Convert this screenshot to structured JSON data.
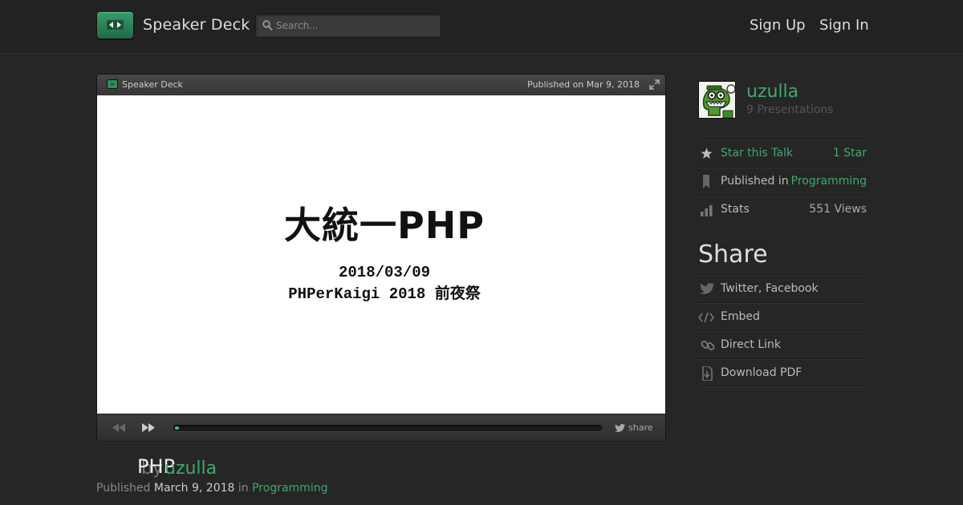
{
  "header": {
    "brand": "Speaker Deck",
    "search_placeholder": "Search...",
    "sign_up": "Sign Up",
    "sign_in": "Sign In"
  },
  "player": {
    "brand": "Speaker Deck",
    "published_on": "Published on Mar 9, 2018",
    "slide": {
      "title": "大統一PHP",
      "date": "2018/03/09",
      "event": "PHPerKaigi 2018 前夜祭"
    },
    "progress_fraction": 0.01,
    "share_label": "share"
  },
  "talk": {
    "title": "PHP",
    "by": "by",
    "author": "uzulla",
    "published_label": "Published",
    "published_date": "March 9, 2018",
    "in_label": "in",
    "category": "Programming"
  },
  "sidebar": {
    "user": {
      "name": "uzulla",
      "presentations": "9 Presentations"
    },
    "star": {
      "label": "Star this Talk",
      "count": "1 Star"
    },
    "published_in": {
      "label": "Published in",
      "value": "Programming"
    },
    "stats": {
      "label": "Stats",
      "value": "551 Views"
    },
    "share_heading": "Share",
    "share_items": [
      {
        "label": "Twitter, Facebook",
        "icon": "twitter-bird-icon"
      },
      {
        "label": "Embed",
        "icon": "code-icon"
      },
      {
        "label": "Direct Link",
        "icon": "link-icon"
      },
      {
        "label": "Download PDF",
        "icon": "download-icon"
      }
    ]
  },
  "colors": {
    "accent": "#3fa86f",
    "background": "#262626",
    "header": "#222222"
  }
}
